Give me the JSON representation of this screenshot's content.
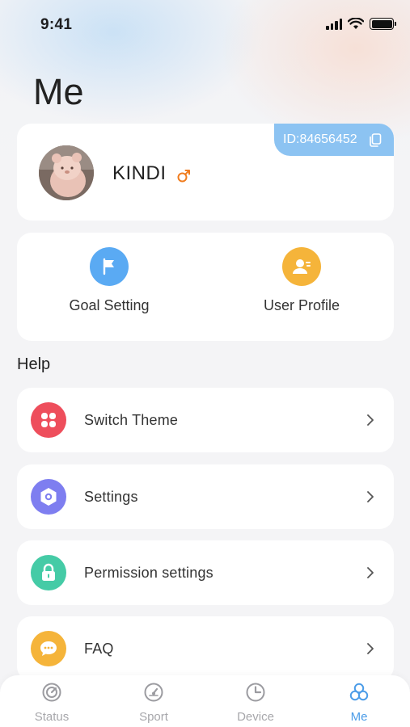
{
  "status_bar": {
    "time": "9:41"
  },
  "page": {
    "title": "Me"
  },
  "profile": {
    "id_label": "ID:84656452",
    "name": "KINDI"
  },
  "quick_actions": [
    {
      "label": "Goal Setting",
      "icon": "flag-icon",
      "color": "#5aaaf3"
    },
    {
      "label": "User Profile",
      "icon": "user-card-icon",
      "color": "#f5b43a"
    }
  ],
  "help": {
    "title": "Help",
    "items": [
      {
        "label": "Switch Theme",
        "icon": "theme-icon",
        "color": "#ee4e5c"
      },
      {
        "label": "Settings",
        "icon": "settings-icon",
        "color": "#7e7ef0"
      },
      {
        "label": "Permission settings",
        "icon": "lock-icon",
        "color": "#45cba6"
      },
      {
        "label": "FAQ",
        "icon": "chat-icon",
        "color": "#f5b43a"
      }
    ]
  },
  "tabs": [
    {
      "label": "Status",
      "icon": "gauge-icon",
      "active": false
    },
    {
      "label": "Sport",
      "icon": "speedometer-icon",
      "active": false
    },
    {
      "label": "Device",
      "icon": "clock-icon",
      "active": false
    },
    {
      "label": "Me",
      "icon": "circles-icon",
      "active": true
    }
  ],
  "colors": {
    "accent": "#4b9ce8",
    "id_tag": "#8cc3f2",
    "gender": "#f07c1e"
  }
}
